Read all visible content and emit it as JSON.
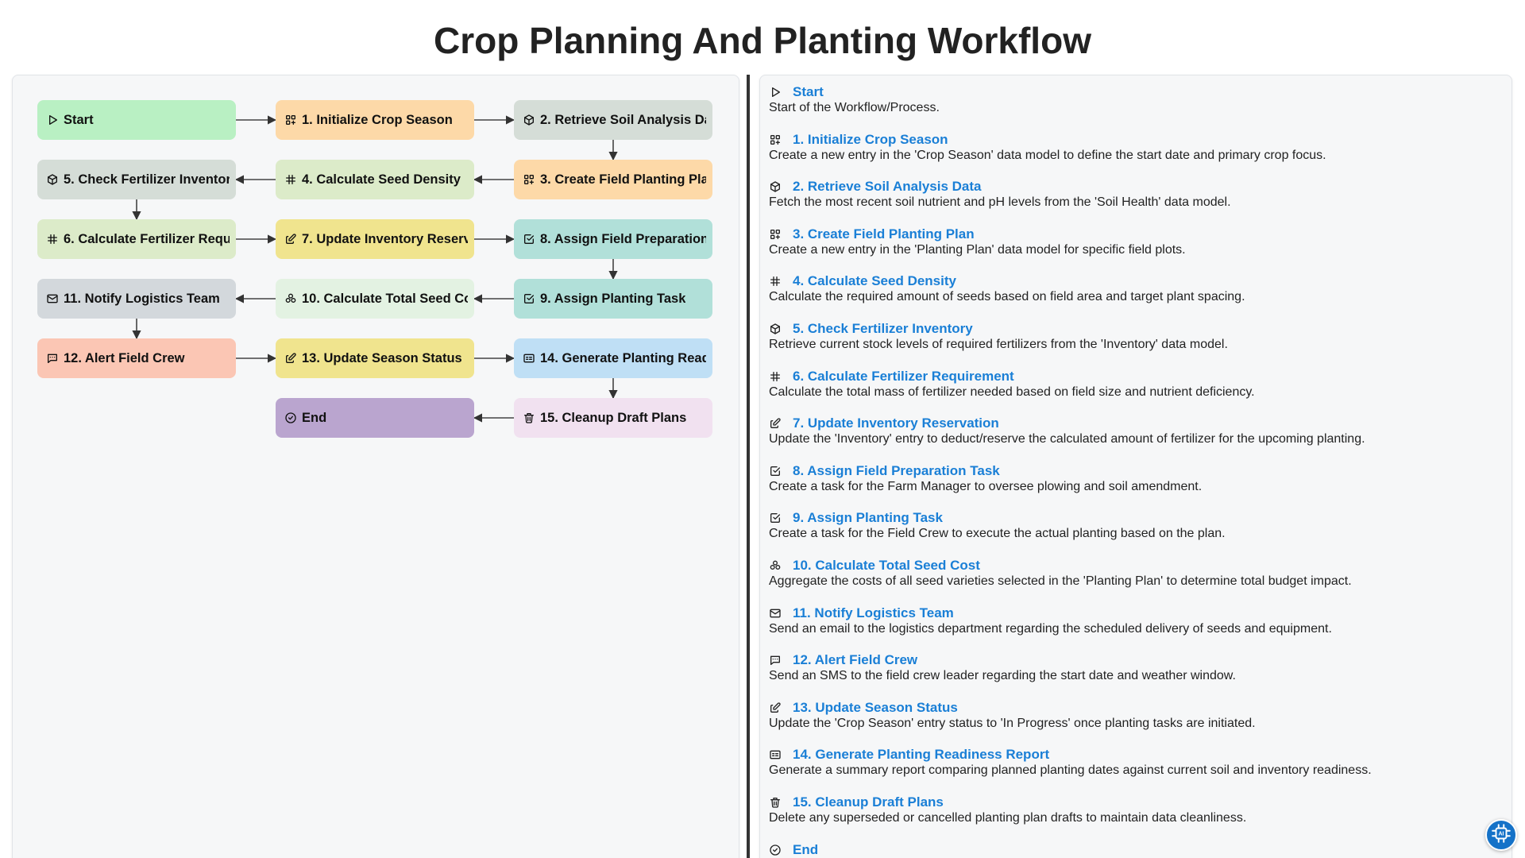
{
  "title": "Crop Planning And Planting Workflow",
  "colors": {
    "green": "#b9f0c3",
    "orange": "#fdd9a8",
    "gray_green": "#d5ddd7",
    "light_green": "#dcebc9",
    "yellow": "#f0e48e",
    "teal": "#b1e0d9",
    "slate": "#d3d8dc",
    "pale_green": "#e3f2e2",
    "salmon": "#fbc6b4",
    "blue": "#bfdff5",
    "purple": "#baa5cf",
    "pink": "#f1e1f0",
    "link": "#1a7fd6"
  },
  "nodes": [
    {
      "label": "Start",
      "icon": "play-icon",
      "color": "#b9f0c3"
    },
    {
      "label": "1. Initialize Crop Season",
      "icon": "grid-add-icon",
      "color": "#fdd9a8"
    },
    {
      "label": "2. Retrieve Soil Analysis Data",
      "icon": "cube-icon",
      "color": "#d5ddd7"
    },
    {
      "label": "3. Create Field Planting Plan",
      "icon": "grid-add-icon",
      "color": "#fdd9a8"
    },
    {
      "label": "4. Calculate Seed Density",
      "icon": "hash-icon",
      "color": "#dcebc9"
    },
    {
      "label": "5. Check Fertilizer Inventory",
      "icon": "cube-icon",
      "color": "#d5ddd7"
    },
    {
      "label": "6. Calculate Fertilizer Requirement",
      "icon": "hash-icon",
      "color": "#dcebc9"
    },
    {
      "label": "7. Update Inventory Reservation",
      "icon": "edit-icon",
      "color": "#f0e48e"
    },
    {
      "label": "8. Assign Field Preparation Task",
      "icon": "checkbox-icon",
      "color": "#b1e0d9"
    },
    {
      "label": "9. Assign Planting Task",
      "icon": "checkbox-icon",
      "color": "#b1e0d9"
    },
    {
      "label": "10. Calculate Total Seed Cost",
      "icon": "coins-icon",
      "color": "#e3f2e2"
    },
    {
      "label": "11. Notify Logistics Team",
      "icon": "mail-icon",
      "color": "#d3d8dc"
    },
    {
      "label": "12. Alert Field Crew",
      "icon": "message-icon",
      "color": "#fbc6b4"
    },
    {
      "label": "13. Update Season Status",
      "icon": "edit-icon",
      "color": "#f0e48e"
    },
    {
      "label": "14. Generate Planting Readiness Report",
      "icon": "report-icon",
      "color": "#bfdff5"
    },
    {
      "label": "15. Cleanup Draft Plans",
      "icon": "trash-icon",
      "color": "#f1e1f0"
    },
    {
      "label": "End",
      "icon": "check-circle-icon",
      "color": "#baa5cf"
    }
  ],
  "steps": [
    {
      "title": "Start",
      "icon": "play-icon",
      "desc": "Start of the Workflow/Process."
    },
    {
      "title": "1. Initialize Crop Season",
      "icon": "grid-add-icon",
      "desc": "Create a new entry in the 'Crop Season' data model to define the start date and primary crop focus."
    },
    {
      "title": "2. Retrieve Soil Analysis Data",
      "icon": "cube-icon",
      "desc": "Fetch the most recent soil nutrient and pH levels from the 'Soil Health' data model."
    },
    {
      "title": "3. Create Field Planting Plan",
      "icon": "grid-add-icon",
      "desc": "Create a new entry in the 'Planting Plan' data model for specific field plots."
    },
    {
      "title": "4. Calculate Seed Density",
      "icon": "hash-icon",
      "desc": "Calculate the required amount of seeds based on field area and target plant spacing."
    },
    {
      "title": "5. Check Fertilizer Inventory",
      "icon": "cube-icon",
      "desc": "Retrieve current stock levels of required fertilizers from the 'Inventory' data model."
    },
    {
      "title": "6. Calculate Fertilizer Requirement",
      "icon": "hash-icon",
      "desc": "Calculate the total mass of fertilizer needed based on field size and nutrient deficiency."
    },
    {
      "title": "7. Update Inventory Reservation",
      "icon": "edit-icon",
      "desc": "Update the 'Inventory' entry to deduct/reserve the calculated amount of fertilizer for the upcoming planting."
    },
    {
      "title": "8. Assign Field Preparation Task",
      "icon": "checkbox-icon",
      "desc": "Create a task for the Farm Manager to oversee plowing and soil amendment."
    },
    {
      "title": "9. Assign Planting Task",
      "icon": "checkbox-icon",
      "desc": "Create a task for the Field Crew to execute the actual planting based on the plan."
    },
    {
      "title": "10. Calculate Total Seed Cost",
      "icon": "coins-icon",
      "desc": "Aggregate the costs of all seed varieties selected in the 'Planting Plan' to determine total budget impact."
    },
    {
      "title": "11. Notify Logistics Team",
      "icon": "mail-icon",
      "desc": "Send an email to the logistics department regarding the scheduled delivery of seeds and equipment."
    },
    {
      "title": "12. Alert Field Crew",
      "icon": "message-icon",
      "desc": "Send an SMS to the field crew leader regarding the start date and weather window."
    },
    {
      "title": "13. Update Season Status",
      "icon": "edit-icon",
      "desc": "Update the 'Crop Season' entry status to 'In Progress' once planting tasks are initiated."
    },
    {
      "title": "14. Generate Planting Readiness Report",
      "icon": "report-icon",
      "desc": "Generate a summary report comparing planned planting dates against current soil and inventory readiness."
    },
    {
      "title": "15. Cleanup Draft Plans",
      "icon": "trash-icon",
      "desc": "Delete any superseded or cancelled planting plan drafts to maintain data cleanliness."
    },
    {
      "title": "End",
      "icon": "check-circle-icon",
      "desc": ""
    }
  ],
  "fab_icon": "ai-chip-icon"
}
